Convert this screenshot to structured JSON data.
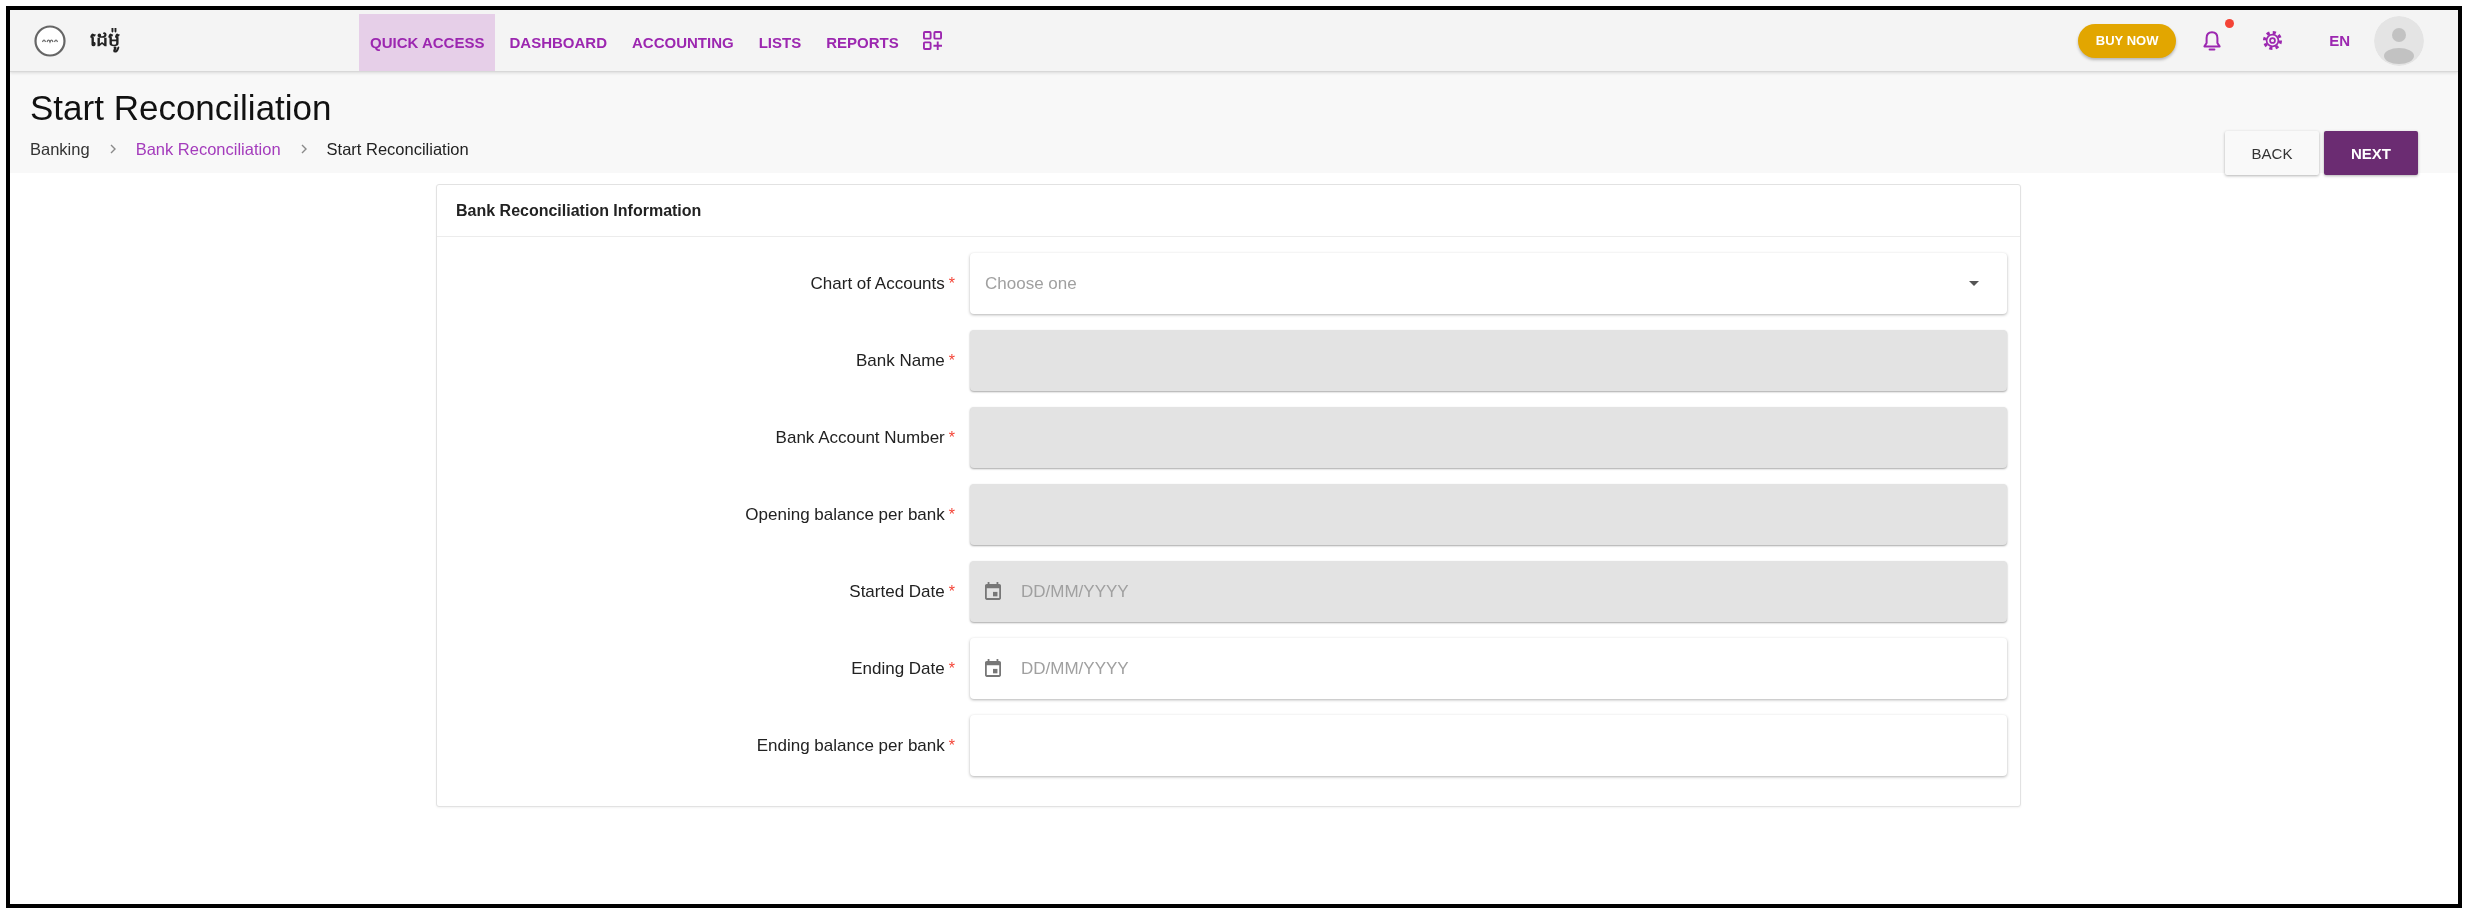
{
  "brand": {
    "name": "ដេម៉ូ"
  },
  "nav": {
    "tabs": [
      {
        "label": "QUICK ACCESS",
        "selected": true
      },
      {
        "label": "DASHBOARD",
        "selected": false
      },
      {
        "label": "ACCOUNTING",
        "selected": false
      },
      {
        "label": "LISTS",
        "selected": false
      },
      {
        "label": "REPORTS",
        "selected": false
      }
    ]
  },
  "toolbar": {
    "buy_button": "BUY NOW",
    "notifications": {
      "unread": true
    },
    "language": "EN"
  },
  "page": {
    "title": "Start Reconciliation",
    "breadcrumb": [
      {
        "label": "Banking",
        "kind": "plain"
      },
      {
        "label": "Bank Reconciliation",
        "kind": "link"
      },
      {
        "label": "Start Reconciliation",
        "kind": "current"
      }
    ],
    "actions": [
      {
        "label": "BACK",
        "kind": "secondary"
      },
      {
        "label": "NEXT",
        "kind": "primary"
      }
    ]
  },
  "form": {
    "title": "Bank Reconciliation Information",
    "fields": [
      {
        "label": "Chart of Accounts",
        "required_mark": "*",
        "kind": "select",
        "placeholder": "Choose one",
        "disabled": false
      },
      {
        "label": "Bank Name",
        "required_mark": "*",
        "kind": "text",
        "disabled": true
      },
      {
        "label": "Bank Account Number",
        "required_mark": "*",
        "kind": "text",
        "disabled": true
      },
      {
        "label": "Opening balance per bank",
        "required_mark": "*",
        "kind": "text",
        "disabled": true
      },
      {
        "label": "Started Date",
        "required_mark": "*",
        "kind": "date",
        "placeholder": "DD/MM/YYYY",
        "disabled": true
      },
      {
        "label": "Ending Date",
        "required_mark": "*",
        "kind": "date",
        "placeholder": "DD/MM/YYYY",
        "disabled": false
      },
      {
        "label": "Ending balance per bank",
        "required_mark": "*",
        "kind": "text",
        "disabled": false
      }
    ]
  }
}
